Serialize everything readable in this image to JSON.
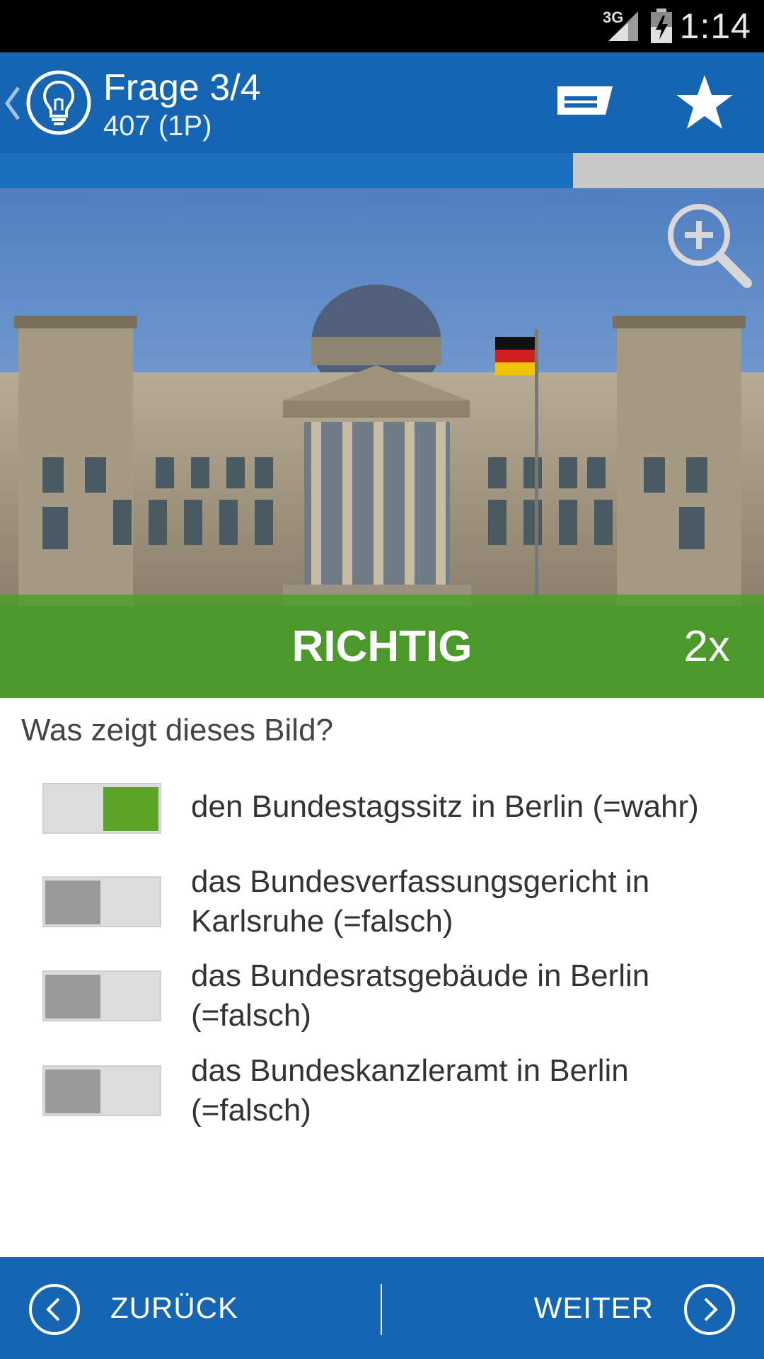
{
  "status_bar": {
    "network": "3G",
    "time": "1:14"
  },
  "header": {
    "title": "Frage 3/4",
    "subtitle": "407 (1P)",
    "icons": [
      "chevron-left-icon",
      "lightbulb-icon",
      "comment-icon",
      "star-icon"
    ]
  },
  "progress": {
    "fraction": 0.75
  },
  "image": {
    "zoom_icon": "zoom-in-icon",
    "result_label": "RICHTIG",
    "result_count": "2x",
    "result_color": "#48a028"
  },
  "question": "Was zeigt dieses Bild?",
  "answers": [
    {
      "text_line1": "den Bundestagssitz in Berlin (=wahr)",
      "text_line2": "",
      "selected": true
    },
    {
      "text_line1": "das Bundesverfassungsgericht in",
      "text_line2": "Karlsruhe (=falsch)",
      "selected": false
    },
    {
      "text_line1": "das Bundesratsgebäude in Berlin",
      "text_line2": "(=falsch)",
      "selected": false
    },
    {
      "text_line1": "das Bundeskanzleramt in Berlin",
      "text_line2": "(=falsch)",
      "selected": false
    }
  ],
  "footer": {
    "back_label": "ZURÜCK",
    "next_label": "WEITER"
  },
  "colors": {
    "primary": "#1565b2",
    "toggle_on": "#5aa428",
    "toggle_off": "#9a9a9a"
  }
}
